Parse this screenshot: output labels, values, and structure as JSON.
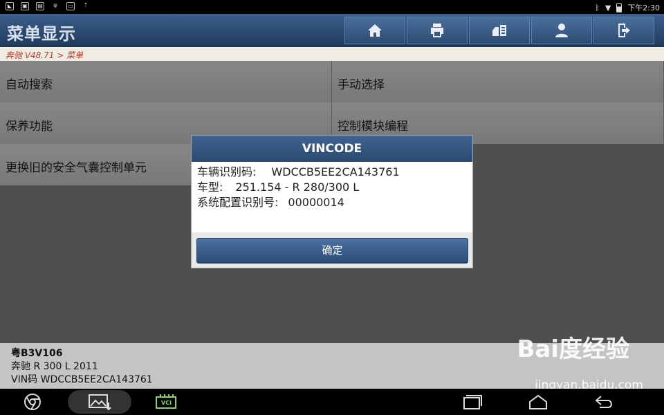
{
  "status_bar": {
    "time": "下午2:30",
    "left_icons": [
      "notification-icon",
      "image-icon",
      "photo-icon",
      "usb-icon",
      "sd-card-icon",
      "upload-icon"
    ],
    "right_icons": [
      "bluetooth-icon",
      "wifi-icon",
      "battery-icon"
    ]
  },
  "header": {
    "title": "菜单显示",
    "toolbar": [
      {
        "name": "home-icon"
      },
      {
        "name": "print-icon"
      },
      {
        "name": "vehicle-icon"
      },
      {
        "name": "user-icon"
      },
      {
        "name": "exit-icon"
      }
    ]
  },
  "breadcrumb": "奔驰 V48.71 > 菜单",
  "menu": {
    "rows": [
      [
        "自动搜索",
        "手动选择"
      ],
      [
        "保养功能",
        "控制模块编程"
      ],
      [
        "更换旧的安全气囊控制单元",
        ""
      ]
    ]
  },
  "dialog": {
    "title": "VINCODE",
    "lines": [
      {
        "label": "车辆识别码:",
        "value": "WDCCB5EE2CA143761"
      },
      {
        "label": "车型:",
        "value": "251.154 - R 280/300 L"
      },
      {
        "label": "系统配置识别号:",
        "value": "00000014"
      }
    ],
    "ok_label": "确定"
  },
  "vehicle_info": {
    "plate": "粤B3V106",
    "model": "奔驰 R 300 L 2011",
    "vin": "VIN码 WDCCB5EE2CA143761"
  },
  "watermark": {
    "brand": "Bai度经验",
    "url": "jingyan.baidu.com"
  },
  "navbar": {
    "vci_label": "VCI"
  },
  "colors": {
    "header": "#2d4c73",
    "breadcrumb_text": "#c0392b",
    "dialog_title": "#2a4a72"
  }
}
